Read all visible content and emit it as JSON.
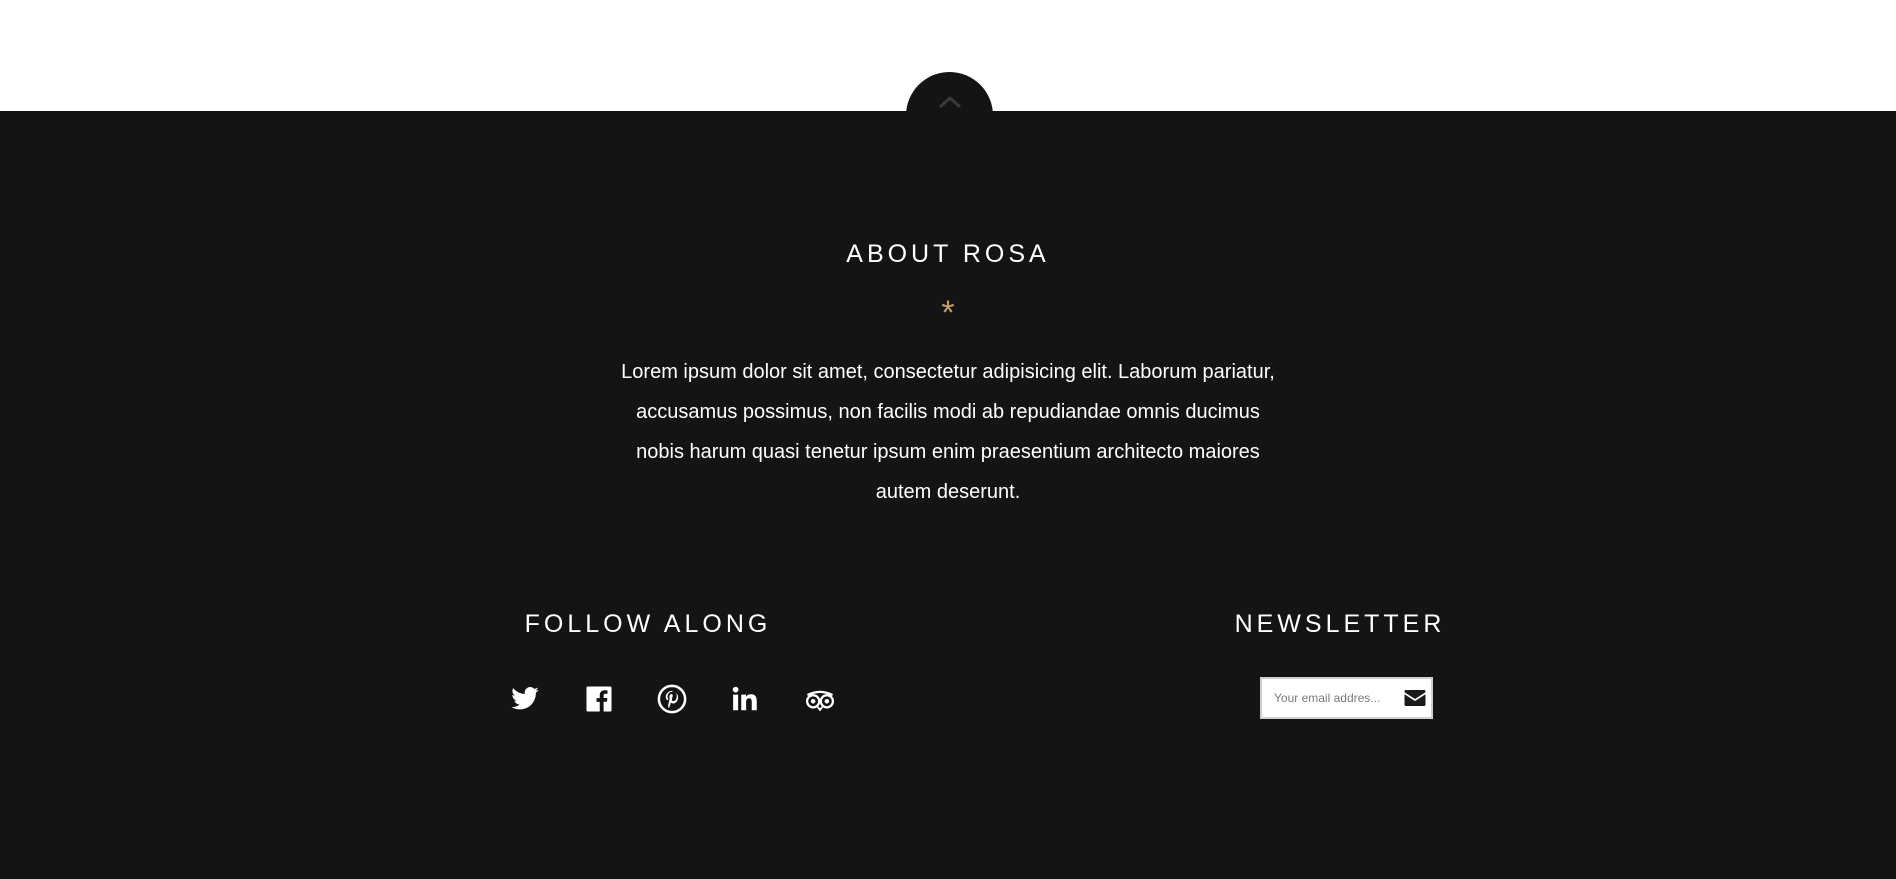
{
  "about": {
    "title": "ABOUT ROSA",
    "divider": "*",
    "text": "Lorem ipsum dolor sit amet, consectetur adipisicing elit. Laborum pariatur, accusamus possimus, non facilis modi ab repudiandae omnis ducimus nobis harum quasi tenetur ipsum enim praesentium architecto maiores autem deserunt."
  },
  "follow": {
    "title": "FOLLOW ALONG",
    "icons": [
      "twitter-icon",
      "facebook-icon",
      "pinterest-icon",
      "linkedin-icon",
      "tripadvisor-icon"
    ]
  },
  "newsletter": {
    "title": "NEWSLETTER",
    "placeholder": "Your email addres...",
    "submit_icon": "envelope-icon"
  },
  "colors": {
    "footer_bg": "#141414",
    "accent": "#c8a064",
    "text": "#ffffff"
  }
}
